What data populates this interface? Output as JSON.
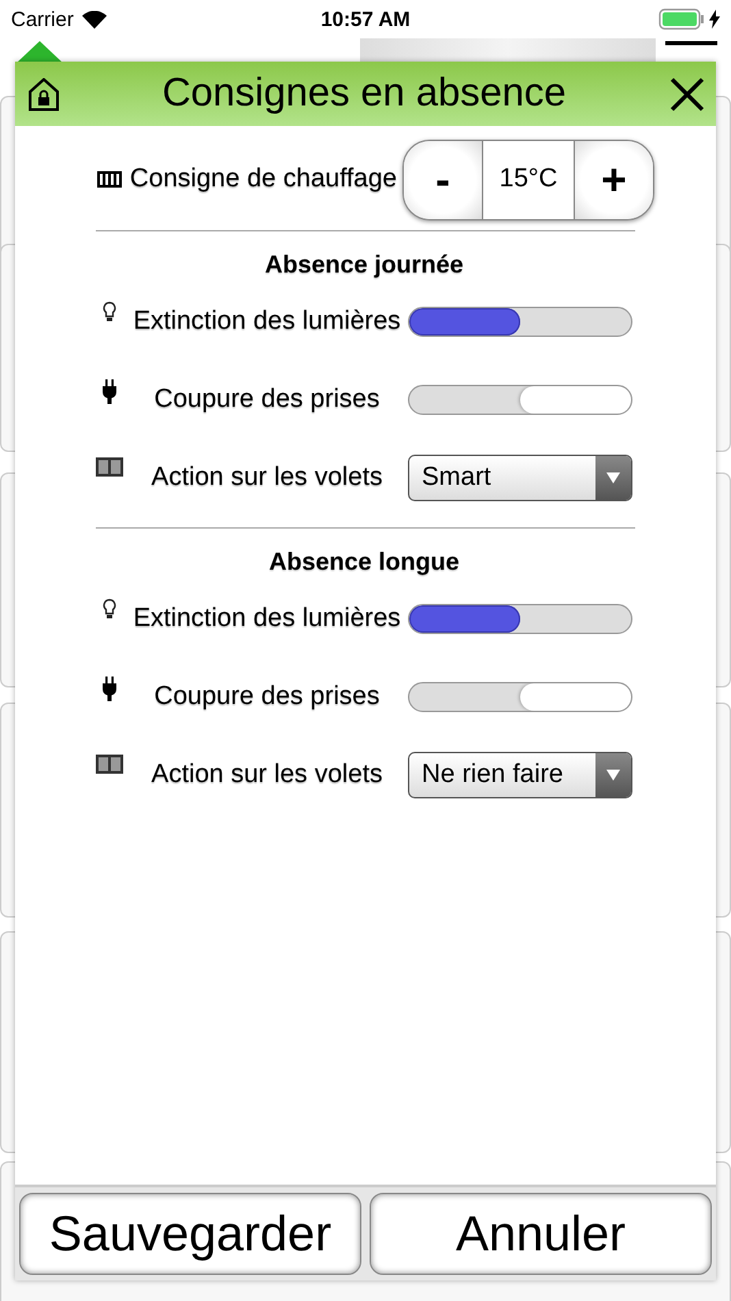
{
  "status_bar": {
    "carrier": "Carrier",
    "time": "10:57 AM"
  },
  "dialog": {
    "title": "Consignes en absence",
    "heating": {
      "label": "Consigne de chauffage",
      "minus": "-",
      "value": "15°C",
      "plus": "+"
    },
    "sections": [
      {
        "title": "Absence journée",
        "rows": [
          {
            "kind": "toggle",
            "label": "Extinction des lumières",
            "on": true
          },
          {
            "kind": "toggle",
            "label": "Coupure des prises",
            "on": false
          },
          {
            "kind": "select",
            "label": "Action sur les volets",
            "value": "Smart"
          }
        ]
      },
      {
        "title": "Absence longue",
        "rows": [
          {
            "kind": "toggle",
            "label": "Extinction des lumières",
            "on": true
          },
          {
            "kind": "toggle",
            "label": "Coupure des prises",
            "on": false
          },
          {
            "kind": "select",
            "label": "Action sur les volets",
            "value": "Ne rien faire"
          }
        ]
      }
    ],
    "buttons": [
      "Sauvegarder",
      "Annuler"
    ]
  }
}
